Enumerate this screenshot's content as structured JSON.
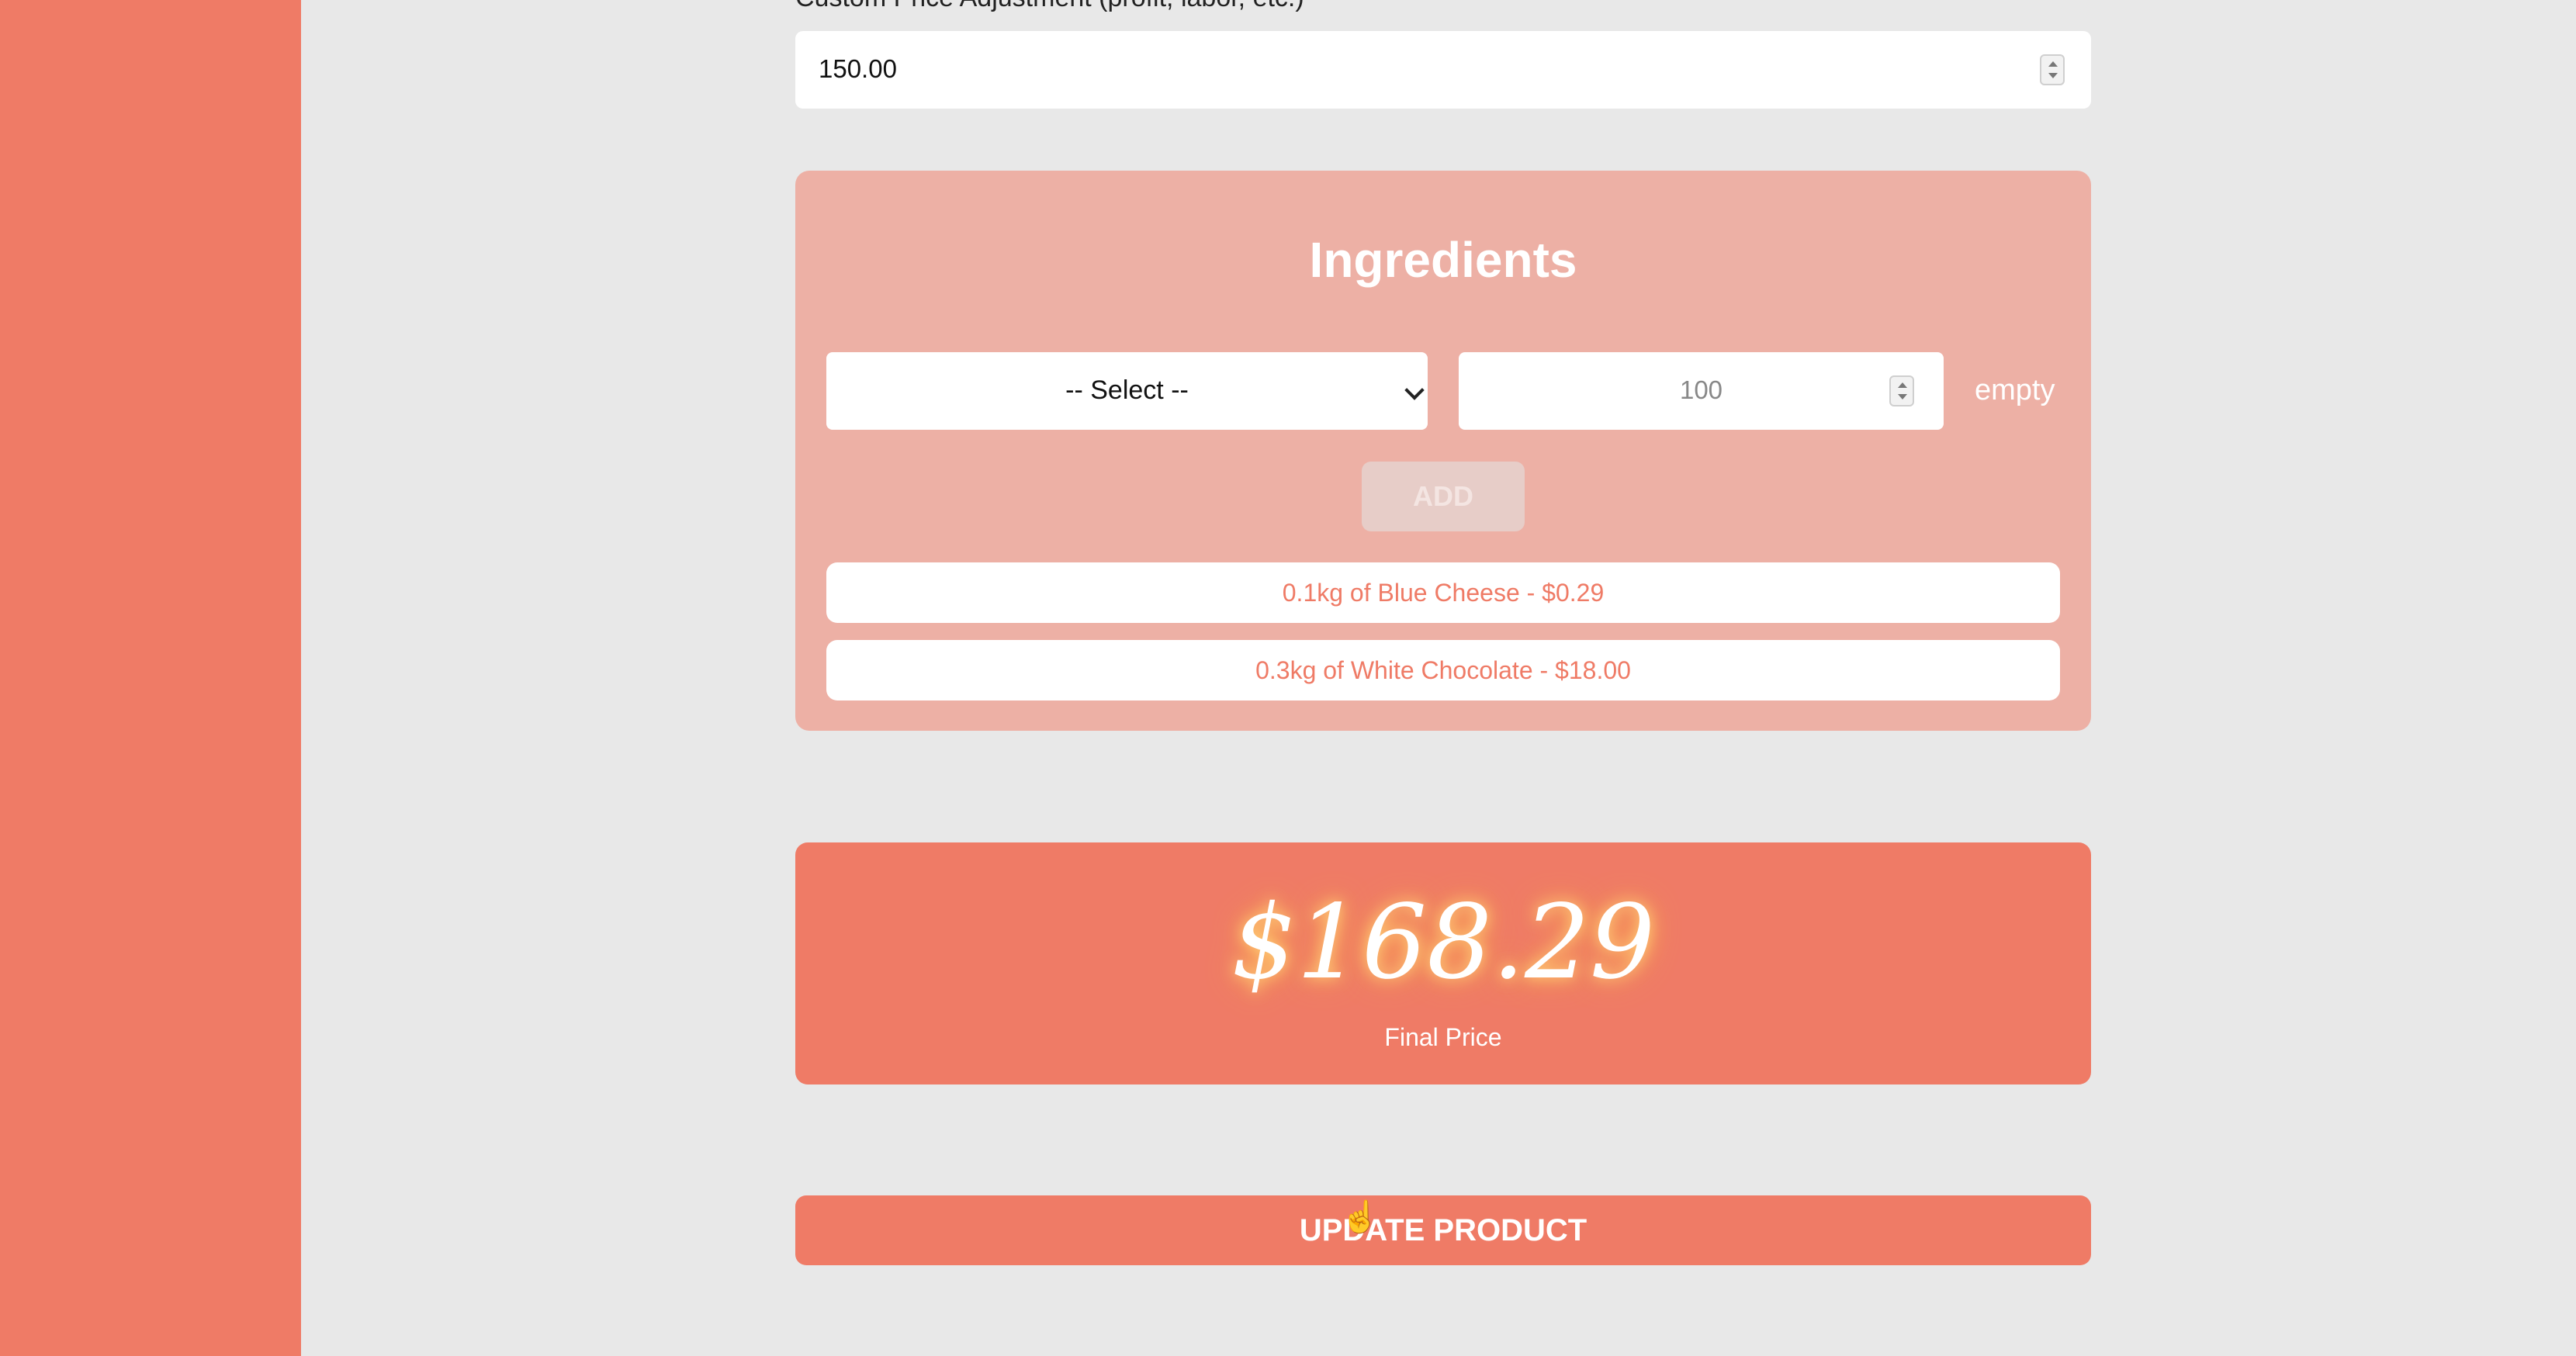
{
  "form": {
    "price_adjustment_label": "Custom Price Adjustment (profit, labor, etc.)",
    "price_adjustment_value": "150.00"
  },
  "ingredients": {
    "title": "Ingredients",
    "select_value": "-- Select --",
    "quantity_placeholder": "100",
    "unit_label": "empty",
    "add_label": "ADD",
    "items": [
      "0.1kg of Blue Cheese - $0.29",
      "0.3kg of White Chocolate - $18.00"
    ]
  },
  "summary": {
    "final_price": "$168.29",
    "final_price_label": "Final Price"
  },
  "actions": {
    "update_label": "UPDATE PRODUCT"
  },
  "colors": {
    "accent": "#ef7b66",
    "card": "#edb0a5",
    "background": "#e8e8e8"
  },
  "icons": {
    "cursor": "hand-pointer-icon"
  }
}
